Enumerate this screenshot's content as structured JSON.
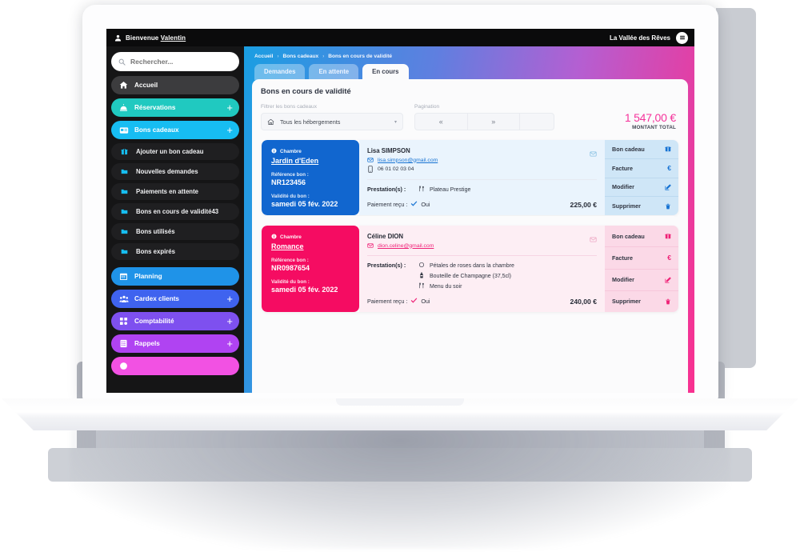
{
  "header": {
    "user_icon": "user-icon",
    "welcome_prefix": "Bienvenue ",
    "user_name": "Valentin",
    "hotel_name": "La Vallée des Rêves",
    "menu_icon": "hamburger-menu-icon"
  },
  "sidebar": {
    "search": {
      "placeholder": "Rechercher...",
      "value": "",
      "icon": "search-icon"
    },
    "items": [
      {
        "label": "Accueil",
        "icon": "home-icon",
        "style": "pill-accueil",
        "plus": false
      },
      {
        "label": "Réservations",
        "icon": "bell-icon",
        "style": "pill-reservations",
        "plus": true
      },
      {
        "label": "Bons cadeaux",
        "icon": "gift-card-icon",
        "style": "pill-bons",
        "plus": true
      }
    ],
    "sub_items": [
      {
        "label": "Ajouter un bon cadeau",
        "icon": "gift-icon",
        "badge": ""
      },
      {
        "label": "Nouvelles demandes",
        "icon": "folder-icon",
        "badge": ""
      },
      {
        "label": "Paiements en attente",
        "icon": "folder-icon",
        "badge": ""
      },
      {
        "label": "Bons en cours de validité",
        "icon": "folder-icon",
        "badge": "43"
      },
      {
        "label": "Bons utilisés",
        "icon": "folder-icon",
        "badge": ""
      },
      {
        "label": "Bons expirés",
        "icon": "folder-icon",
        "badge": ""
      }
    ],
    "items_lower": [
      {
        "label": "Planning",
        "icon": "calendar-icon",
        "style": "pill-planning",
        "plus": false
      },
      {
        "label": "Cardex clients",
        "icon": "people-icon",
        "style": "pill-cardex",
        "plus": true
      },
      {
        "label": "Comptabilité",
        "icon": "grid-icon",
        "style": "pill-compta",
        "plus": true
      },
      {
        "label": "Rappels",
        "icon": "checklist-icon",
        "style": "pill-rappels",
        "plus": true
      }
    ],
    "colors": {
      "accueil": "#3c3c3e",
      "reservations": "#20c9c0",
      "bons_cadeaux": "#17bdf2",
      "planning": "#1f93e8",
      "cardex": "#3f63ef",
      "comptabilite": "#7e50ef",
      "rappels": "#b043f2",
      "last_partial": "#f251e3",
      "sidebar_bg": "#151516"
    }
  },
  "main": {
    "breadcrumb": [
      "Accueil",
      "Bons cadeaux",
      "Bons en cours de validité"
    ],
    "breadcrumb_separator": "›",
    "tabs": [
      {
        "label": "Demandes",
        "active": false
      },
      {
        "label": "En attente",
        "active": false
      },
      {
        "label": "En cours",
        "active": true
      }
    ],
    "panel_title": "Bons en cours de validité",
    "filter": {
      "label": "Filtrer les bons cadeaux",
      "value": "Tous les hébergements",
      "icon": "home-icon",
      "caret": "caret-down-icon"
    },
    "pagination": {
      "label": "Pagination",
      "prev": "«",
      "next": "»"
    },
    "total": {
      "amount": "1 547,00 €",
      "caption": "MONTANT TOTAL",
      "color": "#f5339b"
    },
    "gradient": {
      "from": "#1a9ee2",
      "mid": "#b45fd2",
      "to": "#f9308f"
    },
    "labels": {
      "chambre": "Chambre",
      "reference": "Référence bon :",
      "validite": "Validité du bon :",
      "prestations": "Prestation(s) :",
      "paiement": "Paiement reçu :"
    },
    "actions": [
      {
        "label": "Bon cadeau",
        "icon": "gift-icon"
      },
      {
        "label": "Facture",
        "icon": "euro-icon"
      },
      {
        "label": "Modifier",
        "icon": "edit-icon"
      },
      {
        "label": "Supprimer",
        "icon": "trash-icon"
      }
    ],
    "vouchers": [
      {
        "theme": "v-blue",
        "accent": "#1166cf",
        "chamber": "Jardin d'Eden",
        "reference": "NR123456",
        "validity": "samedi 05 fév. 2022",
        "client_name": "Lisa SIMPSON",
        "email": "lisa.simpson@gmail.com",
        "phone": "06 01 02 03 04",
        "prestations": [
          {
            "icon": "cutlery-icon",
            "label": "Plateau Prestige"
          }
        ],
        "payment": "Oui",
        "amount": "225,00 €"
      },
      {
        "theme": "v-pink",
        "accent": "#f50c62",
        "chamber": "Romance",
        "reference": "NR0987654",
        "validity": "samedi 05 fév. 2022",
        "client_name": "Céline DION",
        "email": "dion.celine@gmail.com",
        "phone": "",
        "prestations": [
          {
            "icon": "rose-petals-icon",
            "label": "Pétales de roses dans la chambre"
          },
          {
            "icon": "champagne-bottle-icon",
            "label": "Bouteille de Champagne (37,5cl)"
          },
          {
            "icon": "cutlery-icon",
            "label": "Menu du soir"
          }
        ],
        "payment": "Oui",
        "amount": "240,00 €"
      }
    ]
  }
}
